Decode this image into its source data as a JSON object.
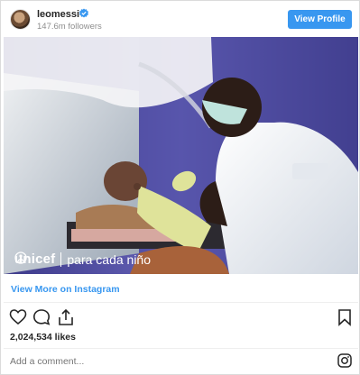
{
  "header": {
    "username": "leomessi",
    "followers": "147.6m followers",
    "view_profile_label": "View Profile"
  },
  "photo": {
    "brand_name": "unicef",
    "brand_tagline": "para cada niño"
  },
  "post": {
    "view_more_label": "View More on Instagram",
    "likes": "2,024,534 likes",
    "comment_placeholder": "Add a comment..."
  },
  "colors": {
    "accent": "#3897f0",
    "text": "#262626",
    "muted": "#8e8e8e"
  },
  "icons": [
    "verified-badge-icon",
    "heart-icon",
    "comment-icon",
    "share-icon",
    "bookmark-icon",
    "instagram-icon",
    "unicef-logo-icon"
  ]
}
